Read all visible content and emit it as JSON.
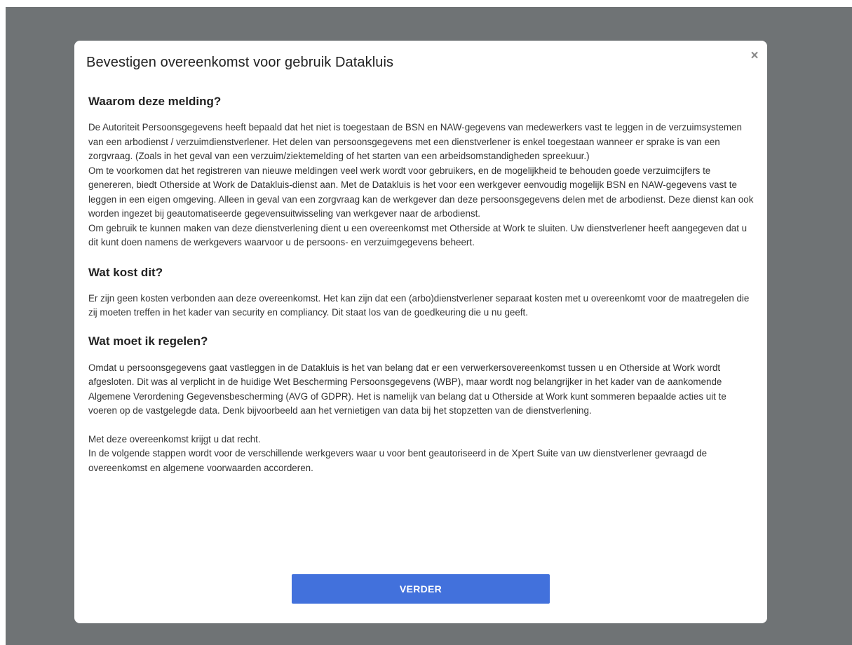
{
  "modal": {
    "title": "Bevestigen overeenkomst voor gebruik Datakluis",
    "close_symbol": "×",
    "close_icon": "close-icon"
  },
  "sections": [
    {
      "heading": "Waarom deze melding?",
      "paragraphs": [
        "De Autoriteit Persoonsgegevens heeft bepaald dat het niet is toegestaan de BSN en NAW-gegevens van medewerkers vast te leggen in de verzuimsystemen van een arbodienst / verzuimdienstverlener. Het delen van persoonsgegevens met een dienstverlener is enkel toegestaan wanneer er sprake is van een zorgvraag. (Zoals in het geval van een verzuim/ziektemelding of het starten van een arbeidsomstandigheden spreekuur.)",
        "Om te voorkomen dat het registreren van nieuwe meldingen veel werk wordt voor gebruikers, en de mogelijkheid te behouden goede verzuimcijfers te genereren, biedt Otherside at Work de Datakluis-dienst aan. Met de Datakluis is het voor een werkgever eenvoudig mogelijk BSN en NAW-gegevens vast te leggen in een eigen omgeving. Alleen in geval van een zorgvraag kan de werkgever dan deze persoonsgegevens delen met de arbodienst. Deze dienst kan ook worden ingezet bij geautomatiseerde gegevensuitwisseling van werkgever naar de arbodienst.",
        "Om gebruik te kunnen maken van deze dienstverlening dient u een overeenkomst met Otherside at Work te sluiten. Uw dienstverlener heeft aangegeven dat u dit kunt doen namens de werkgevers waarvoor u de persoons- en verzuimgegevens beheert."
      ]
    },
    {
      "heading": "Wat kost dit?",
      "paragraphs": [
        "Er zijn geen kosten verbonden aan deze overeenkomst. Het kan zijn dat een (arbo)dienstverlener separaat kosten met u overeenkomt voor de maatregelen die zij moeten treffen in het kader van security en compliancy. Dit staat los van de goedkeuring die u nu geeft."
      ]
    },
    {
      "heading": "Wat moet ik regelen?",
      "paragraphs": [
        "Omdat u persoonsgegevens gaat vastleggen in de Datakluis is het van belang dat er een verwerkersovereenkomst tussen u en Otherside at Work wordt afgesloten. Dit was al verplicht in de huidige Wet Bescherming Persoonsgegevens (WBP), maar wordt nog belangrijker in het kader van de aankomende Algemene Verordening Gegevensbescherming (AVG of GDPR). Het is namelijk van belang dat u Otherside at Work kunt sommeren bepaalde acties uit te voeren op de vastgelegde data. Denk bijvoorbeeld aan het vernietigen van data bij het stopzetten van de dienstverlening.",
        "Met deze overeenkomst krijgt u dat recht.",
        "In de volgende stappen wordt voor de verschillende werkgevers waar u voor bent geautoriseerd in de Xpert Suite van uw dienstverlener gevraagd de overeenkomst en algemene voorwaarden accorderen."
      ]
    }
  ],
  "actions": {
    "continue_label": "VERDER"
  },
  "colors": {
    "backdrop": "#6f7375",
    "modal_background": "#ffffff",
    "primary_button": "#4271dc"
  }
}
